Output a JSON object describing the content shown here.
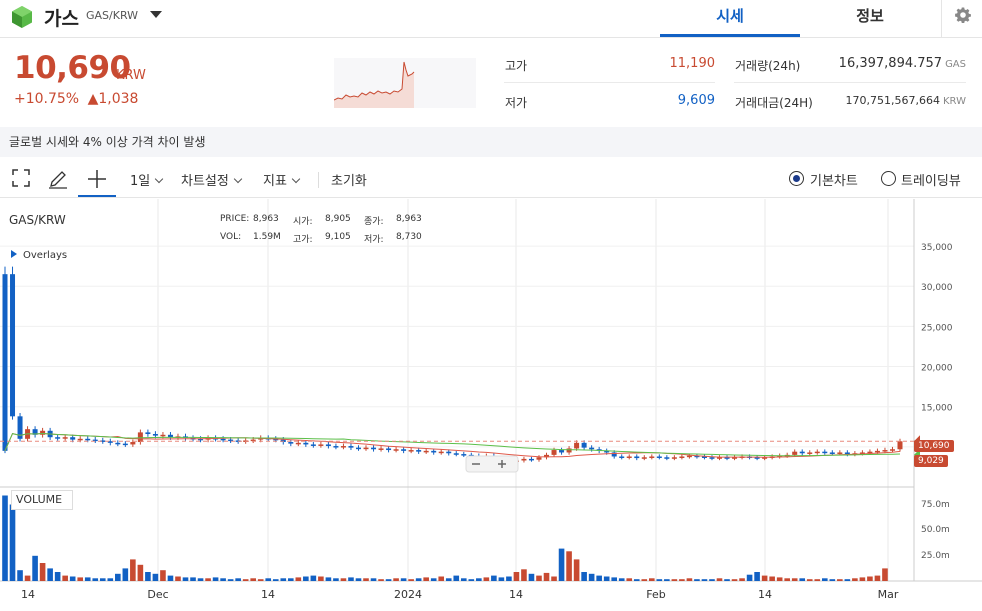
{
  "header": {
    "coin_name": "가스",
    "pair": "GAS/KRW",
    "tabs": [
      "시세",
      "정보"
    ]
  },
  "summary": {
    "price": "10,690",
    "unit": "KRW",
    "change_pct": "+10.75%",
    "change_abs": "▲1,038",
    "high_label": "고가",
    "high_value": "11,190",
    "low_label": "저가",
    "low_value": "9,609",
    "volume_label": "거래량(24h)",
    "volume_value": "16,397,894.757",
    "volume_unit": "GAS",
    "amount_label": "거래대금(24H)",
    "amount_value": "170,751,567,664",
    "amount_unit": "KRW"
  },
  "notice": "글로벌 시세와 4% 이상 가격 차이 발생",
  "toolbar": {
    "period": "1일",
    "chart_settings": "차트설정",
    "indicators": "지표",
    "reset": "초기화",
    "basic_chart": "기본차트",
    "trading_view": "트레이딩뷰"
  },
  "legend": {
    "pair": "GAS/KRW",
    "price_label": "PRICE:",
    "price": "8,963",
    "open_label": "시가:",
    "open": "8,905",
    "close_label": "종가:",
    "close": "8,963",
    "vol_label": "VOL:",
    "vol": "1.59M",
    "high_label": "고가:",
    "high": "9,105",
    "low_label": "저가:",
    "low": "8,730",
    "overlays": "Overlays",
    "volume": "VOLUME"
  },
  "colors": {
    "up": "#c84a31",
    "down": "#1261c4",
    "accent": "#1261c4"
  },
  "chart_data": {
    "type": "candlestick",
    "price_axis": [
      "35,000",
      "30,000",
      "25,000",
      "20,000",
      "15,000",
      "10,000"
    ],
    "volume_axis": [
      "75.0m",
      "50.0m",
      "25.0m"
    ],
    "x_labels": [
      "14",
      "Dec",
      "14",
      "2024",
      "14",
      "Feb",
      "14",
      "Mar"
    ],
    "last_price_tag": "10,690",
    "ma_tag": "9,029",
    "ylim": [
      5000,
      37000
    ],
    "closes": [
      9500,
      13800,
      11000,
      12200,
      11500,
      12000,
      11200,
      11100,
      11200,
      10900,
      11000,
      10900,
      10800,
      10700,
      10500,
      10400,
      10300,
      10600,
      11800,
      11600,
      11400,
      11500,
      11200,
      11300,
      11100,
      11000,
      10900,
      11100,
      11000,
      10900,
      10800,
      10700,
      10800,
      10900,
      11100,
      11000,
      10900,
      10600,
      10400,
      10500,
      10300,
      10200,
      10300,
      10100,
      10000,
      10100,
      9900,
      9800,
      9900,
      9700,
      9800,
      9600,
      9700,
      9500,
      9600,
      9400,
      9500,
      9300,
      9400,
      9200,
      9100,
      9000,
      8900,
      8700,
      8900,
      8600,
      8400,
      8200,
      8300,
      8500,
      8400,
      8700,
      9000,
      9600,
      9300,
      9800,
      10500,
      9900,
      9700,
      9500,
      9300,
      8800,
      8700,
      8800,
      8600,
      8700,
      8800,
      8700,
      8600,
      8700,
      8800,
      8900,
      8800,
      8700,
      8600,
      8700,
      8600,
      8700,
      8800,
      8700,
      8600,
      8700,
      8800,
      8900,
      9000,
      9400,
      9200,
      9300,
      9400,
      9300,
      9200,
      9300,
      9100,
      9200,
      9300,
      9400,
      9500,
      9600,
      9700,
      10690
    ],
    "volumes": [
      95,
      85,
      12,
      6,
      28,
      20,
      14,
      10,
      6,
      5,
      4,
      4,
      3,
      3,
      3,
      8,
      14,
      24,
      18,
      10,
      8,
      12,
      6,
      5,
      4,
      4,
      3,
      3,
      4,
      3,
      2,
      3,
      2,
      3,
      2,
      3,
      2,
      3,
      3,
      4,
      5,
      6,
      5,
      4,
      3,
      3,
      4,
      3,
      3,
      3,
      2,
      2,
      3,
      3,
      2,
      3,
      4,
      3,
      5,
      3,
      6,
      3,
      2,
      3,
      4,
      6,
      4,
      5,
      10,
      13,
      8,
      6,
      9,
      5,
      36,
      33,
      24,
      10,
      8,
      6,
      5,
      4,
      3,
      3,
      2,
      2,
      3,
      2,
      2,
      2,
      2,
      3,
      2,
      2,
      2,
      3,
      2,
      2,
      3,
      7,
      10,
      6,
      5,
      4,
      3,
      3,
      3,
      2,
      2,
      3,
      2,
      2,
      2,
      3,
      4,
      5,
      6,
      14
    ]
  }
}
